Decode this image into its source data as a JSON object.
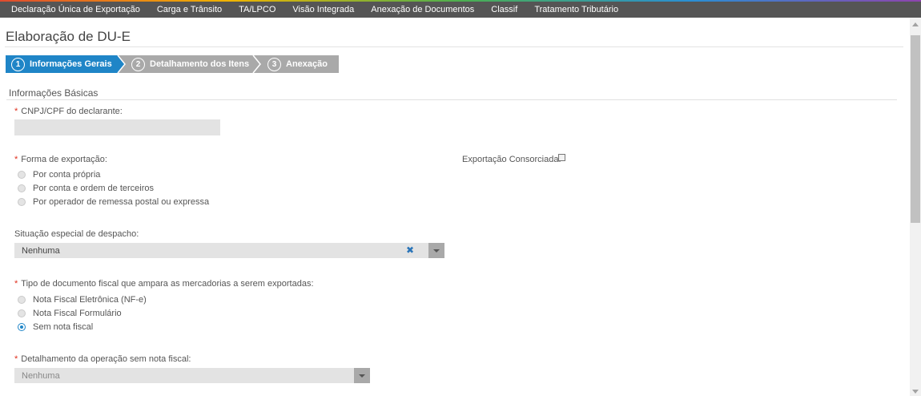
{
  "nav": {
    "items": [
      "Declaração Única de Exportação",
      "Carga e Trânsito",
      "TA/LPCO",
      "Visão Integrada",
      "Anexação de Documentos",
      "Classif",
      "Tratamento Tributário"
    ]
  },
  "page": {
    "title": "Elaboração de DU-E"
  },
  "steps": [
    {
      "number": "1",
      "label": "Informações Gerais",
      "active": true
    },
    {
      "number": "2",
      "label": "Detalhamento dos Itens",
      "active": false
    },
    {
      "number": "3",
      "label": "Anexação",
      "active": false
    }
  ],
  "section": {
    "title": "Informações Básicas"
  },
  "form": {
    "required_marker": "*",
    "cnpj": {
      "label": "CNPJ/CPF do declarante:",
      "value": ""
    },
    "forma": {
      "label": "Forma de exportação:",
      "options": [
        "Por conta própria",
        "Por conta e ordem de terceiros",
        "Por operador de remessa postal ou expressa"
      ]
    },
    "consorciada": {
      "label": "Exportação Consorciada:",
      "checked": false
    },
    "situacao": {
      "label": "Situação especial de despacho:",
      "value": "Nenhuma",
      "clear": "✖"
    },
    "tipo_doc": {
      "label": "Tipo de documento fiscal que ampara as mercadorias a serem exportadas:",
      "options": [
        "Nota Fiscal Eletrônica (NF-e)",
        "Nota Fiscal Formulário",
        "Sem nota fiscal"
      ],
      "selected": "Sem nota fiscal"
    },
    "detalhamento": {
      "label": "Detalhamento da operação sem nota fiscal:",
      "value": "Nenhuma"
    }
  },
  "colors": {
    "accent": "#1f85c7",
    "step_inactive": "#a9a9a9",
    "nav_bg": "#555555",
    "required": "#e0301e"
  }
}
